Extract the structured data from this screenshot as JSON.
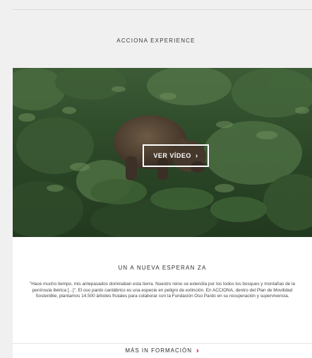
{
  "section": {
    "title": "ACCIONA EXPERIENCE"
  },
  "video": {
    "button_label": "VER VÍDEO",
    "button_icon": "chevron-right-icon"
  },
  "article": {
    "title": "UN A NUEVA ESPERAN ZA",
    "body": "\"Hace mucho tiempo, mis antepasados dominaban esta tierra. Nuestro reino se extendía por los todos los bosques y montañas de la península ibérica [...]\". El oso pardo cantábrico es una especie en peligro de extinción. En ACCIONA, dentro del Plan de Movilidad Sostenible, plantamos 14.500 árboles frutales para colaborar con la Fundación Oso Pardo en su recuperación y supervivencia.",
    "more_label": "MÁS IN FORMACIÓN",
    "more_icon": "chevron-right-icon"
  },
  "colors": {
    "accent": "#e2001a",
    "background": "#f0f0f0",
    "card": "#ffffff"
  }
}
